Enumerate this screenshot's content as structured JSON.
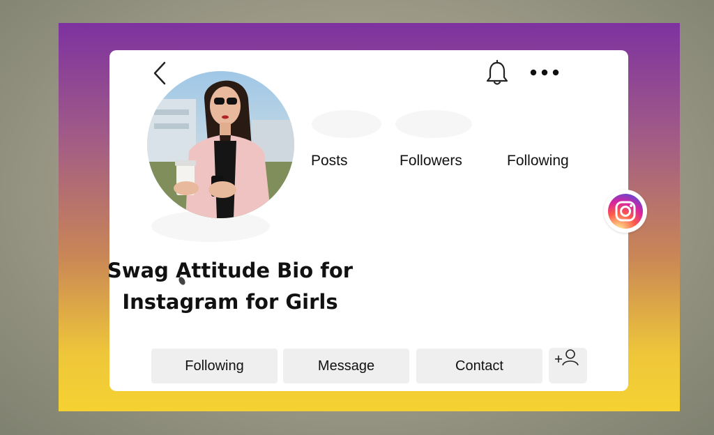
{
  "profile": {
    "stats": [
      {
        "label": "Posts"
      },
      {
        "label": "Followers"
      },
      {
        "label": "Following"
      }
    ]
  },
  "headline": {
    "line1": "Swag Attitude Bio for",
    "line2": "Instagram for Girls"
  },
  "actions": {
    "following_label": "Following",
    "message_label": "Message",
    "contact_label": "Contact"
  },
  "icons": {
    "back": "chevron-left-icon",
    "notifications": "bell-icon",
    "more": "more-horizontal-icon",
    "add_user": "add-user-icon",
    "instagram": "instagram-logo"
  },
  "colors": {
    "gradient_top": "#7d32a0",
    "gradient_bottom": "#f5d232",
    "button_bg": "#efefef",
    "text": "#111111"
  }
}
